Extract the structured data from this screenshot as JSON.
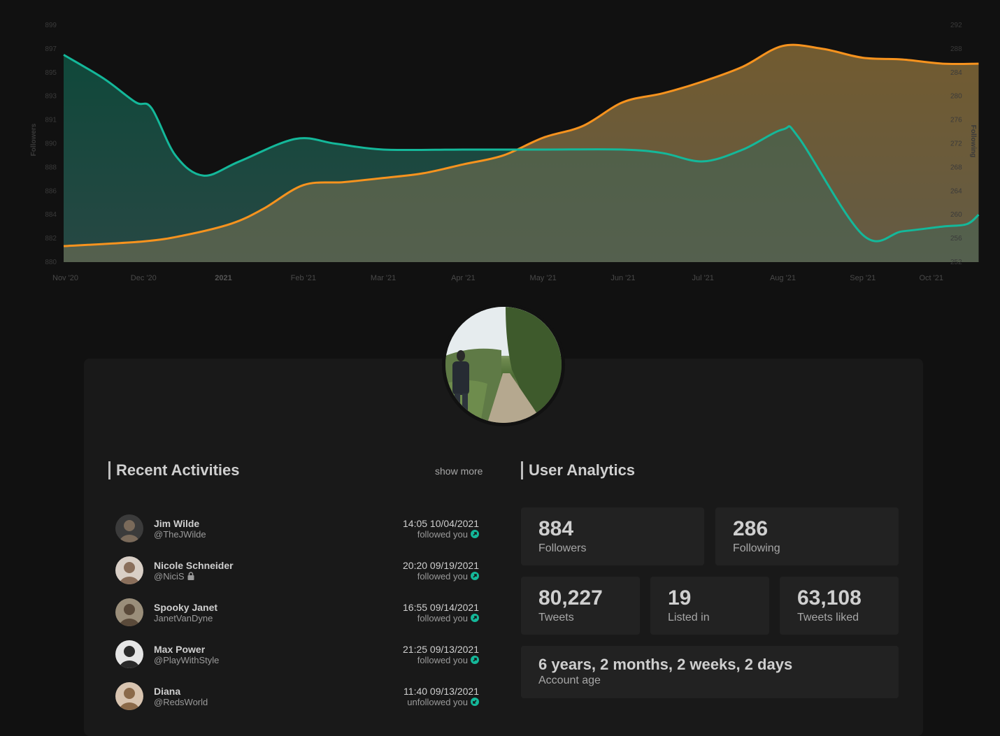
{
  "chart_data": {
    "type": "area",
    "x": [
      "Nov '20",
      "Dec '20",
      "2021",
      "Feb '21",
      "Mar '21",
      "Apr '21",
      "May '21",
      "Jun '21",
      "Jul '21",
      "Aug '21",
      "Sep '21",
      "Oct '21"
    ],
    "yaxis_left": {
      "label": "Followers",
      "ticks": [
        "880",
        "882",
        "884",
        "886",
        "888",
        "890",
        "891",
        "893",
        "895",
        "897",
        "899"
      ],
      "ylim": [
        880,
        900
      ]
    },
    "yaxis_right": {
      "label": "Following",
      "ticks": [
        "252",
        "256",
        "260",
        "264",
        "268",
        "272",
        "276",
        "280",
        "284",
        "288",
        "292"
      ],
      "ylim": [
        252,
        292
      ]
    },
    "series": [
      {
        "name": "Followers",
        "axis": "left",
        "color": "#14b89a",
        "points": [
          [
            0,
            897.5
          ],
          [
            0.5,
            895.5
          ],
          [
            0.9,
            893.5
          ],
          [
            1.1,
            893.0
          ],
          [
            1.4,
            889.0
          ],
          [
            1.75,
            887.3
          ],
          [
            2.2,
            888.5
          ],
          [
            2.9,
            890.4
          ],
          [
            3.4,
            890.0
          ],
          [
            4.0,
            889.5
          ],
          [
            5.0,
            889.5
          ],
          [
            6.0,
            889.5
          ],
          [
            7.0,
            889.5
          ],
          [
            7.5,
            889.2
          ],
          [
            8.0,
            888.5
          ],
          [
            8.5,
            889.5
          ],
          [
            9.0,
            891.2
          ],
          [
            9.2,
            890.5
          ],
          [
            10.0,
            882.3
          ],
          [
            10.5,
            882.6
          ],
          [
            11.0,
            883.0
          ],
          [
            11.3,
            883.2
          ],
          [
            11.45,
            884.0
          ]
        ]
      },
      {
        "name": "Following",
        "axis": "right",
        "color": "#f7931e",
        "points": [
          [
            0,
            254.7
          ],
          [
            1.0,
            255.5
          ],
          [
            1.5,
            256.5
          ],
          [
            2.1,
            258.5
          ],
          [
            2.5,
            261.0
          ],
          [
            3.0,
            265.0
          ],
          [
            3.5,
            265.5
          ],
          [
            4.0,
            266.2
          ],
          [
            4.5,
            267.0
          ],
          [
            5.0,
            268.5
          ],
          [
            5.5,
            270.0
          ],
          [
            6.0,
            273.0
          ],
          [
            6.5,
            275.0
          ],
          [
            7.0,
            279.0
          ],
          [
            7.5,
            280.5
          ],
          [
            8.0,
            282.5
          ],
          [
            8.5,
            285.0
          ],
          [
            9.0,
            288.5
          ],
          [
            9.5,
            288.0
          ],
          [
            10.0,
            286.5
          ],
          [
            10.5,
            286.2
          ],
          [
            11.0,
            285.5
          ],
          [
            11.45,
            285.5
          ]
        ]
      }
    ],
    "grid": false,
    "legend": "none"
  },
  "profile": {
    "avatar_icon": "profile-photo"
  },
  "recent": {
    "title": "Recent Activities",
    "show_more": "show more",
    "items": [
      {
        "name": "Jim Wilde",
        "handle": "@TheJWilde",
        "time": "14:05 10/04/2021",
        "status": "followed you",
        "icon": "arrow-up-right-icon",
        "locked": false
      },
      {
        "name": "Nicole Schneider",
        "handle": "@NiciS",
        "time": "20:20 09/19/2021",
        "status": "followed you",
        "icon": "arrow-up-right-icon",
        "locked": true
      },
      {
        "name": "Spooky Janet",
        "handle": "JanetVanDyne",
        "time": "16:55 09/14/2021",
        "status": "followed you",
        "icon": "arrow-up-right-icon",
        "locked": false
      },
      {
        "name": "Max Power",
        "handle": "@PlayWithStyle",
        "time": "21:25 09/13/2021",
        "status": "followed you",
        "icon": "arrow-up-right-icon",
        "locked": false
      },
      {
        "name": "Diana",
        "handle": "@RedsWorld",
        "time": "11:40 09/13/2021",
        "status": "unfollowed you",
        "icon": "arrow-down-left-icon",
        "locked": false
      }
    ]
  },
  "analytics": {
    "title": "User Analytics",
    "followers": {
      "value": "884",
      "label": "Followers"
    },
    "following": {
      "value": "286",
      "label": "Following"
    },
    "tweets": {
      "value": "80,227",
      "label": "Tweets"
    },
    "listed": {
      "value": "19",
      "label": "Listed in"
    },
    "liked": {
      "value": "63,108",
      "label": "Tweets liked"
    },
    "age": {
      "value": "6 years, 2 months, 2 weeks, 2 days",
      "label": "Account age"
    }
  }
}
